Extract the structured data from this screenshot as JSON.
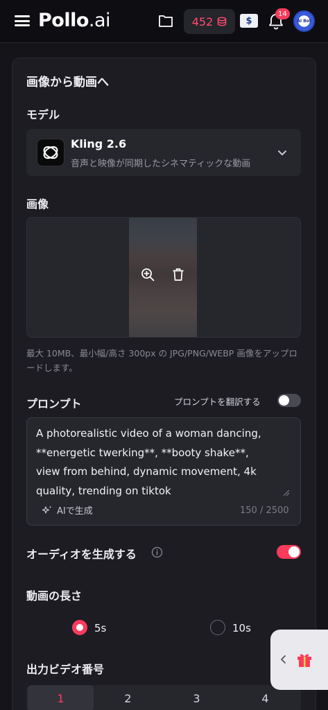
{
  "header": {
    "logo_main": "Pollo",
    "logo_suffix": ".ai",
    "credits": "452",
    "notification_count": "14",
    "avatar_text": "AI Bot"
  },
  "panel": {
    "title": "画像から動画へ",
    "model": {
      "label": "モデル",
      "name": "Kling 2.6",
      "description": "音声と映像が同期したシネマティックな動画"
    },
    "image": {
      "label": "画像",
      "hint": "最大 10MB、最小幅/高さ 300px の JPG/PNG/WEBP 画像をアップロードします。"
    },
    "prompt": {
      "label": "プロンプト",
      "translate_label": "プロンプトを翻訳する",
      "translate_enabled": false,
      "text": "A photorealistic video of a woman dancing,\n**energetic twerking**, **booty shake**,\nview from behind, dynamic movement, 4k\nquality, trending on tiktok",
      "ai_generate_label": "AIで生成",
      "char_count": "150 / 2500"
    },
    "audio": {
      "label": "オーディオを生成する",
      "enabled": true
    },
    "duration": {
      "label": "動画の長さ",
      "options": [
        "5s",
        "10s"
      ],
      "selected": "5s"
    },
    "output_count": {
      "label": "出力ビデオ番号",
      "options": [
        "1",
        "2",
        "3",
        "4"
      ],
      "selected": "1"
    }
  },
  "colors": {
    "accent": "#ff3b5c",
    "background": "#141419",
    "panel": "#1c1c22"
  }
}
